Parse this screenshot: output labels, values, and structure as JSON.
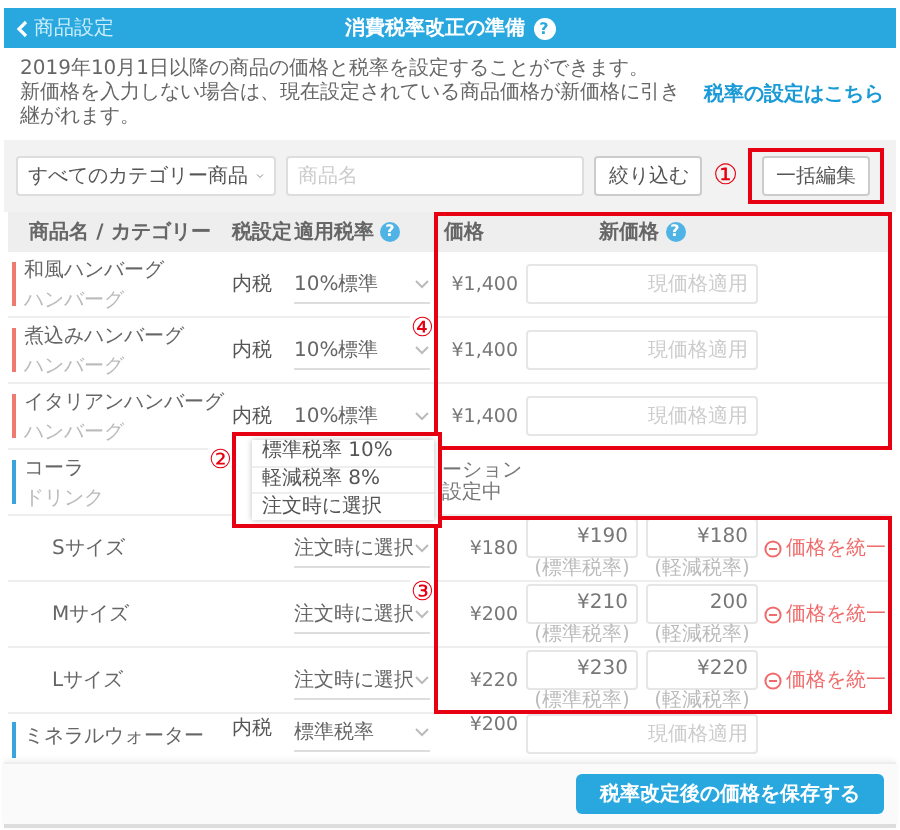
{
  "header": {
    "back": "商品設定",
    "title": "消費税率改正の準備",
    "help": "?"
  },
  "description": {
    "lines": [
      "2019年10月1日以降の商品の価格と税率を設定することができます。",
      "新価格を入力しない場合は、現在設定されている商品価格が新価格に引き継がれます。"
    ],
    "link": "税率の設定はこちら"
  },
  "filter": {
    "category": "すべてのカテゴリー商品",
    "search_placeholder": "商品名",
    "filter_button": "絞り込む",
    "bulk_edit_button": "一括編集"
  },
  "markers": [
    "①",
    "②",
    "③",
    "④"
  ],
  "columns": [
    {
      "label": "商品名 / カテゴリー"
    },
    {
      "label": "税設定"
    },
    {
      "label": "適用税率",
      "help": "?"
    },
    {
      "label": "価格"
    },
    {
      "label": "新価格",
      "help": "?"
    }
  ],
  "rows": [
    {
      "kind": "product",
      "name": "和風ハンバーグ",
      "category": "ハンバーグ",
      "color": "#ef7b70",
      "tax": "内税",
      "rate": "10%標準",
      "price": "¥1,400",
      "placeholder": "現価格適用"
    },
    {
      "kind": "product",
      "name": "煮込みハンバーグ",
      "category": "ハンバーグ",
      "color": "#ef7b70",
      "tax": "内税",
      "rate": "10%標準",
      "price": "¥1,400",
      "placeholder": "現価格適用"
    },
    {
      "kind": "product",
      "name": "イタリアンハンバーグ",
      "category": "ハンバーグ",
      "color": "#ef7b70",
      "tax": "内税",
      "rate": "10%標準",
      "price": "¥1,400",
      "placeholder": "現価格適用"
    },
    {
      "kind": "group",
      "name": "コーラ",
      "category": "ドリンク",
      "color": "#3aa5dc",
      "note": [
        "ーション",
        "設定中"
      ]
    },
    {
      "kind": "variant",
      "name": "Sサイズ",
      "rate": "注文時に選択",
      "price": "¥180",
      "standard_price": "¥190",
      "standard_caption": "(標準税率)",
      "reduced_price": "¥180",
      "reduced_caption": "(軽減税率)",
      "unify": "価格を統一"
    },
    {
      "kind": "variant",
      "name": "Mサイズ",
      "rate": "注文時に選択",
      "price": "¥200",
      "standard_price": "¥210",
      "standard_caption": "(標準税率)",
      "reduced_price": "200",
      "reduced_caption": "(軽減税率)",
      "unify": "価格を統一"
    },
    {
      "kind": "variant",
      "name": "Lサイズ",
      "rate": "注文時に選択",
      "price": "¥220",
      "standard_price": "¥230",
      "standard_caption": "(標準税率)",
      "reduced_price": "¥220",
      "reduced_caption": "(軽減税率)",
      "unify": "価格を統一"
    },
    {
      "kind": "product",
      "name": "ミネラルウォーター",
      "color": "#3aa5dc",
      "tax": "内税",
      "rate": "標準税率",
      "price": "¥200",
      "placeholder": "現価格適用"
    }
  ],
  "rate_menu": {
    "options": [
      "標準税率 10%",
      "軽減税率 8%",
      "注文時に選択"
    ]
  },
  "save_button": "税率改定後の価格を保存する"
}
